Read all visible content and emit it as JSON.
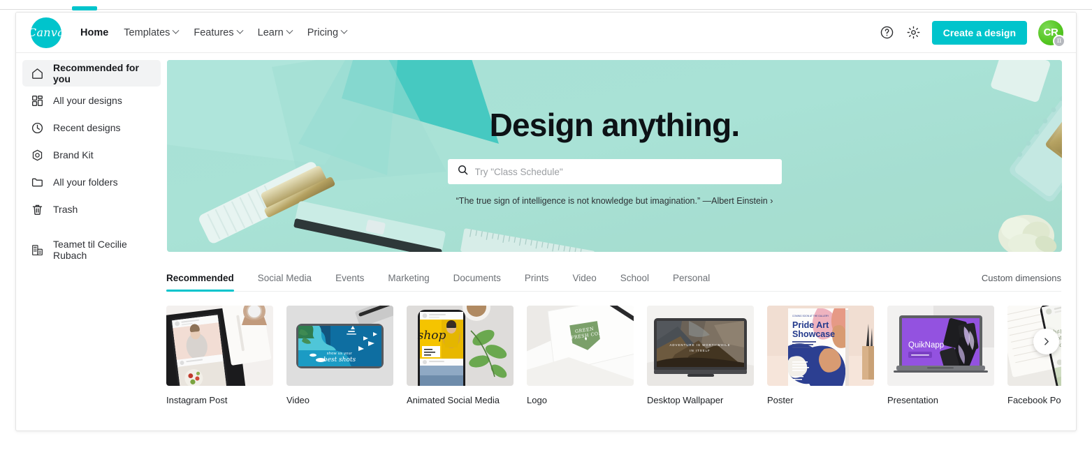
{
  "brand": {
    "logo_text": "Canva",
    "accent": "#00c4cc"
  },
  "header": {
    "nav": [
      {
        "label": "Home",
        "active": true,
        "caret": false
      },
      {
        "label": "Templates",
        "active": false,
        "caret": true
      },
      {
        "label": "Features",
        "active": false,
        "caret": true
      },
      {
        "label": "Learn",
        "active": false,
        "caret": true
      },
      {
        "label": "Pricing",
        "active": false,
        "caret": true
      }
    ],
    "help_icon": "help-circle-icon",
    "settings_icon": "gear-icon",
    "create_button": "Create a design",
    "avatar_initials": "CR",
    "avatar_badge": "π"
  },
  "sidebar": {
    "items": [
      {
        "label": "Recommended for you",
        "icon": "home-icon",
        "active": true
      },
      {
        "label": "All your designs",
        "icon": "grid-icon",
        "active": false
      },
      {
        "label": "Recent designs",
        "icon": "clock-icon",
        "active": false
      },
      {
        "label": "Brand Kit",
        "icon": "brand-kit-icon",
        "active": false
      },
      {
        "label": "All your folders",
        "icon": "folder-icon",
        "active": false
      },
      {
        "label": "Trash",
        "icon": "trash-icon",
        "active": false
      }
    ],
    "team": {
      "label": "Teamet til Cecilie Rubach",
      "icon": "building-icon"
    }
  },
  "hero": {
    "title": "Design anything.",
    "search_placeholder": "Try \"Class Schedule\"",
    "search_value": "",
    "search_icon": "search-icon",
    "quote": "“The true sign of intelligence is not knowledge but imagination.” —Albert Einstein ›"
  },
  "categories": {
    "tabs": [
      {
        "label": "Recommended",
        "active": true
      },
      {
        "label": "Social Media",
        "active": false
      },
      {
        "label": "Events",
        "active": false
      },
      {
        "label": "Marketing",
        "active": false
      },
      {
        "label": "Documents",
        "active": false
      },
      {
        "label": "Prints",
        "active": false
      },
      {
        "label": "Video",
        "active": false
      },
      {
        "label": "School",
        "active": false
      },
      {
        "label": "Personal",
        "active": false
      }
    ],
    "custom_dimensions": "Custom dimensions"
  },
  "templates": {
    "next_arrow": "›",
    "cards": [
      {
        "label": "Instagram Post",
        "art": "phone-notebook"
      },
      {
        "label": "Video",
        "art": "phone-ocean"
      },
      {
        "label": "Animated Social Media",
        "art": "phone-shop"
      },
      {
        "label": "Logo",
        "art": "envelope-logo"
      },
      {
        "label": "Desktop Wallpaper",
        "art": "monitor-mountain"
      },
      {
        "label": "Poster",
        "art": "pride-poster"
      },
      {
        "label": "Presentation",
        "art": "laptop-quiknapp"
      },
      {
        "label": "Facebook Post",
        "art": "phone-flowers"
      }
    ],
    "art_text": {
      "phone_ocean_line1": "show us your",
      "phone_ocean_line2": "best shots",
      "phone_shop": "shop",
      "envelope_logo_line1": "GREEN",
      "envelope_logo_line2": "FRESH CO.",
      "monitor_caption_line1": "ADVENTURE IS WORTHWHILE",
      "monitor_caption_line2": "IN ITSELF",
      "poster_title_line1": "Pride Art",
      "poster_title_line2": "Showcase",
      "laptop_title": "QuikNapp"
    }
  }
}
